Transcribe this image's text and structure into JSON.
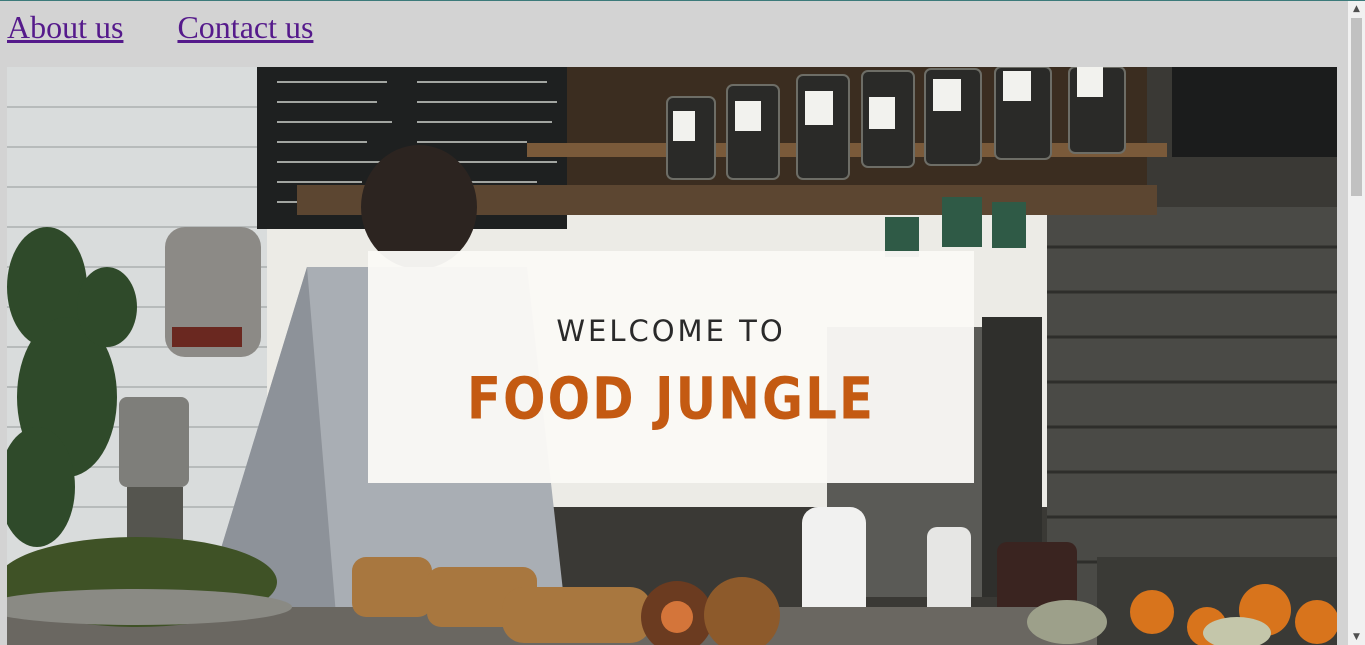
{
  "nav": {
    "links": [
      {
        "label": "About us"
      },
      {
        "label": "Contact us"
      }
    ]
  },
  "hero": {
    "welcome_text": "WELCOME TO",
    "brand_name": "FOOD JUNGLE",
    "image_subject": "cafe-counter-photo"
  },
  "colors": {
    "page_background": "#d3d3d3",
    "link_visited": "#551a8b",
    "brand_orange": "#c45a12",
    "card_background": "#faf9f6"
  },
  "icons": {
    "scroll_up": "triangle-up-icon",
    "scroll_down": "triangle-down-icon"
  }
}
